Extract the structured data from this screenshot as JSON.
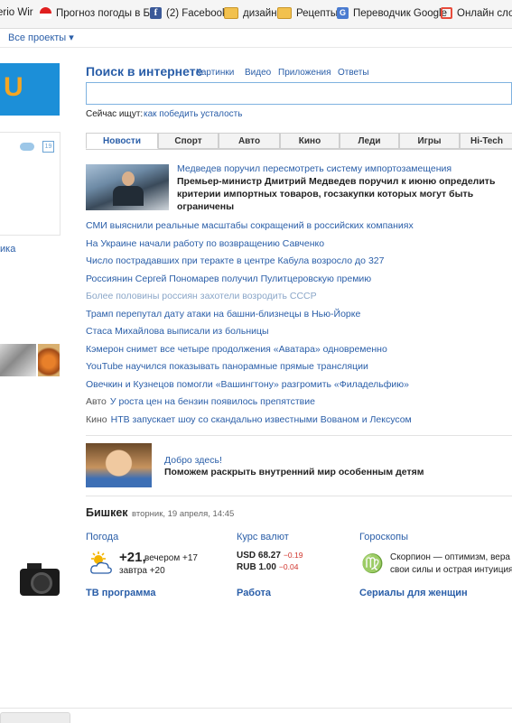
{
  "bookmarks": [
    {
      "icon": "flag-icon",
      "label": "erio Wir"
    },
    {
      "icon": "umbrella-icon",
      "label": "Прогноз погоды в Б"
    },
    {
      "icon": "facebook-icon",
      "label": "(2) Facebook"
    },
    {
      "icon": "folder-icon",
      "label": "дизайн"
    },
    {
      "icon": "folder-icon",
      "label": "Рецепты"
    },
    {
      "icon": "google-translate-icon",
      "label": "Переводчик Google"
    },
    {
      "icon": "dictionary-icon",
      "label": "Онлайн слова"
    }
  ],
  "projects_menu": "Все проекты ▾",
  "left": {
    "logo_letter": "U",
    "calendar_day": "19",
    "link_fragment": "ика"
  },
  "search": {
    "title": "Поиск в интернете",
    "tabs": [
      "Картинки",
      "Видео",
      "Приложения",
      "Ответы"
    ],
    "value": "",
    "trend_label": "Сейчас ищут:",
    "trend_link": "как победить усталость"
  },
  "news_tabs": [
    "Новости",
    "Спорт",
    "Авто",
    "Кино",
    "Леди",
    "Игры",
    "Hi-Tech"
  ],
  "lead": {
    "title": "Медведев поручил пересмотреть систему импортозамещения",
    "text": "Премьер-министр Дмитрий Медведев поручил к июню определить критерии импортных товаров, госзакупки которых могут быть ограничены"
  },
  "news": [
    {
      "prefix": "",
      "text": "СМИ выяснили реальные масштабы сокращений в российских компаниях"
    },
    {
      "prefix": "",
      "text": "На Украине начали работу по возвращению Савченко"
    },
    {
      "prefix": "",
      "text": "Число пострадавших при теракте в центре Кабула возросло до 327"
    },
    {
      "prefix": "",
      "text": "Россиянин Сергей Пономарев получил Пулитцеровскую премию"
    },
    {
      "prefix": "",
      "text": "Более половины россиян захотели возродить СССР"
    },
    {
      "prefix": "",
      "text": "Трамп перепутал дату атаки на башни-близнецы в Нью-Йорке"
    },
    {
      "prefix": "",
      "text": "Стаса Михайлова выписали из больницы"
    },
    {
      "prefix": "",
      "text": "Кэмерон снимет все четыре продолжения «Аватара» одновременно"
    },
    {
      "prefix": "",
      "text": "YouTube научился показывать панорамные прямые трансляции"
    },
    {
      "prefix": "",
      "text": "Овечкин и Кузнецов помогли «Вашингтону» разгромить «Филадельфию»"
    },
    {
      "prefix": "Авто",
      "text": "У роста цен на бензин появилось препятствие"
    },
    {
      "prefix": "Кино",
      "text": "НТВ запускает шоу со скандально известными Вованом и Лексусом"
    }
  ],
  "promo": {
    "title": "Добро здесь!",
    "text": "Поможем раскрыть внутренний мир особенным детям"
  },
  "city": {
    "name": "Бишкек",
    "date": "вторник, 19 апреля, 14:45"
  },
  "weather": {
    "heading": "Погода",
    "temp": "+21,",
    "evening": "вечером +17",
    "tomorrow": "завтра +20"
  },
  "currency": {
    "heading": "Курс валют",
    "rows": [
      {
        "code": "USD",
        "value": "68.27",
        "change": "−0.19"
      },
      {
        "code": "RUB",
        "value": "1.00",
        "change": "−0.04"
      }
    ]
  },
  "horoscope": {
    "heading": "Гороскопы",
    "symbol": "♍",
    "line1": "Скорпион — оптимизм, вера",
    "line2": "свои силы и острая интуиция"
  },
  "bottom_links": [
    "ТВ программа",
    "Работа",
    "Сериалы для женщин"
  ]
}
